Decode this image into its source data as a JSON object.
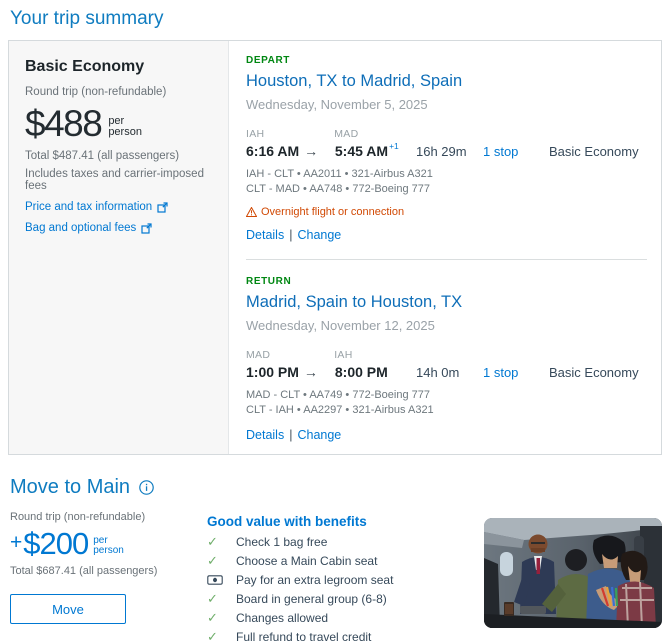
{
  "page": {
    "title": "Your trip summary"
  },
  "icons": {
    "check": "✓",
    "arrow_right": "→"
  },
  "colors": {
    "brand_blue": "#0078d2",
    "heading_blue": "#0f7cc0",
    "green_direction": "#008712",
    "warning_orange": "#d14904",
    "check_green": "#6fae6a",
    "panel_gray": "#f7f7f7"
  },
  "summary_card": {
    "fare": {
      "name": "Basic Economy",
      "trip_type": "Round trip (non-refundable)",
      "price": "$488",
      "per": "per",
      "person": "person",
      "total": "Total $487.41 (all passengers)",
      "includes": "Includes taxes and carrier-imposed fees",
      "price_tax_link": "Price and tax information",
      "bag_fees_link": "Bag and optional fees"
    },
    "slices": [
      {
        "direction": "DEPART",
        "route": "Houston, TX to Madrid, Spain",
        "date": "Wednesday, November 5, 2025",
        "origin_code": "IAH",
        "dest_code": "MAD",
        "depart_time": "6:16 AM",
        "arrive_time": "5:45 AM",
        "arrive_plus": "+1",
        "duration": "16h 29m",
        "stops": "1 stop",
        "cabin": "Basic Economy",
        "segments": [
          "IAH - CLT • AA2011 • 321-Airbus A321",
          "CLT - MAD • AA748 • 772-Boeing 777"
        ],
        "warning": "Overnight flight or connection",
        "details_label": "Details",
        "separator": "|",
        "change_label": "Change"
      },
      {
        "direction": "RETURN",
        "route": "Madrid, Spain to Houston, TX",
        "date": "Wednesday, November 12, 2025",
        "origin_code": "MAD",
        "dest_code": "IAH",
        "depart_time": "1:00 PM",
        "arrive_time": "8:00 PM",
        "duration": "14h 0m",
        "stops": "1 stop",
        "cabin": "Basic Economy",
        "segments": [
          "MAD - CLT • AA749 • 772-Boeing 777",
          "CLT - IAH • AA2297 • 321-Airbus A321"
        ],
        "details_label": "Details",
        "separator": "|",
        "change_label": "Change"
      }
    ]
  },
  "upsell": {
    "title": "Move to Main",
    "trip_type": "Round trip (non-refundable)",
    "plus": "+",
    "price": "$200",
    "per": "per",
    "person": "person",
    "total": "Total $687.41 (all passengers)",
    "move_button": "Move",
    "benefits_title": "Good value with benefits",
    "benefits": [
      {
        "icon": "check",
        "label": "Check 1 bag free"
      },
      {
        "icon": "check",
        "label": "Choose a Main Cabin seat"
      },
      {
        "icon": "money",
        "label": "Pay for an extra legroom seat"
      },
      {
        "icon": "check",
        "label": "Board in general group (6-8)"
      },
      {
        "icon": "check",
        "label": "Changes allowed"
      },
      {
        "icon": "check",
        "label": "Full refund to travel credit"
      }
    ],
    "photo_alt": "cabin-photo"
  }
}
